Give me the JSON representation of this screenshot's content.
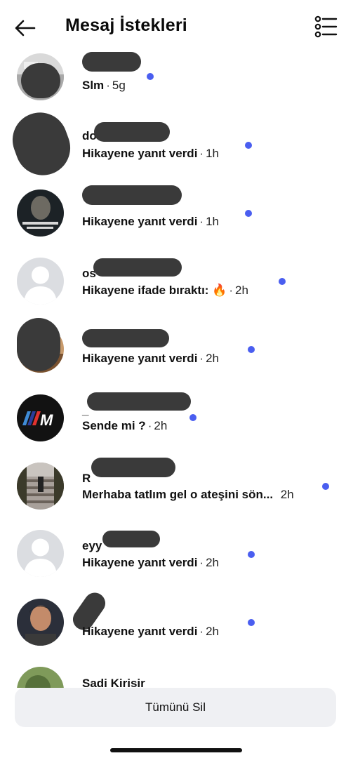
{
  "header": {
    "title": "Mesaj İstekleri",
    "back_icon": "arrow-left-icon",
    "filter_icon": "list-filter-icon"
  },
  "requests": [
    {
      "name": "",
      "message": "Slm",
      "time": "5g",
      "avatar": "avatar-photo-1"
    },
    {
      "name": "do",
      "message": "Hikayene yanıt verdi",
      "time": "1h",
      "avatar": "avatar-photo-2"
    },
    {
      "name": "",
      "message": "Hikayene yanıt verdi",
      "time": "1h",
      "avatar": "avatar-statue-image"
    },
    {
      "name": "os",
      "message": "Hikayene ifade bıraktı: 🔥",
      "time": "2h",
      "avatar": "default-avatar"
    },
    {
      "name": "",
      "message": "Hikayene yanıt verdi",
      "time": "2h",
      "avatar": "avatar-photo-5"
    },
    {
      "name": "_",
      "message": "Sende mi ?",
      "time": "2h",
      "avatar": "bmw-m-logo"
    },
    {
      "name": "R",
      "message": "Merhaba tatlım gel o ateşini sön...",
      "time": "2h",
      "avatar": "avatar-stairs-photo"
    },
    {
      "name": "eyy",
      "message": "Hikayene yanıt verdi",
      "time": "2h",
      "avatar": "default-avatar"
    },
    {
      "name": "",
      "message": "Hikayene yanıt verdi",
      "time": "2h",
      "avatar": "avatar-man-photo"
    },
    {
      "name": "Sadi Kirisir",
      "message": "",
      "time": "",
      "avatar": "avatar-tree-photo"
    }
  ],
  "footer": {
    "delete_all_label": "Tümünü Sil"
  },
  "colors": {
    "unread_dot": "#4a5ef0",
    "button_bg": "#eff0f3"
  }
}
